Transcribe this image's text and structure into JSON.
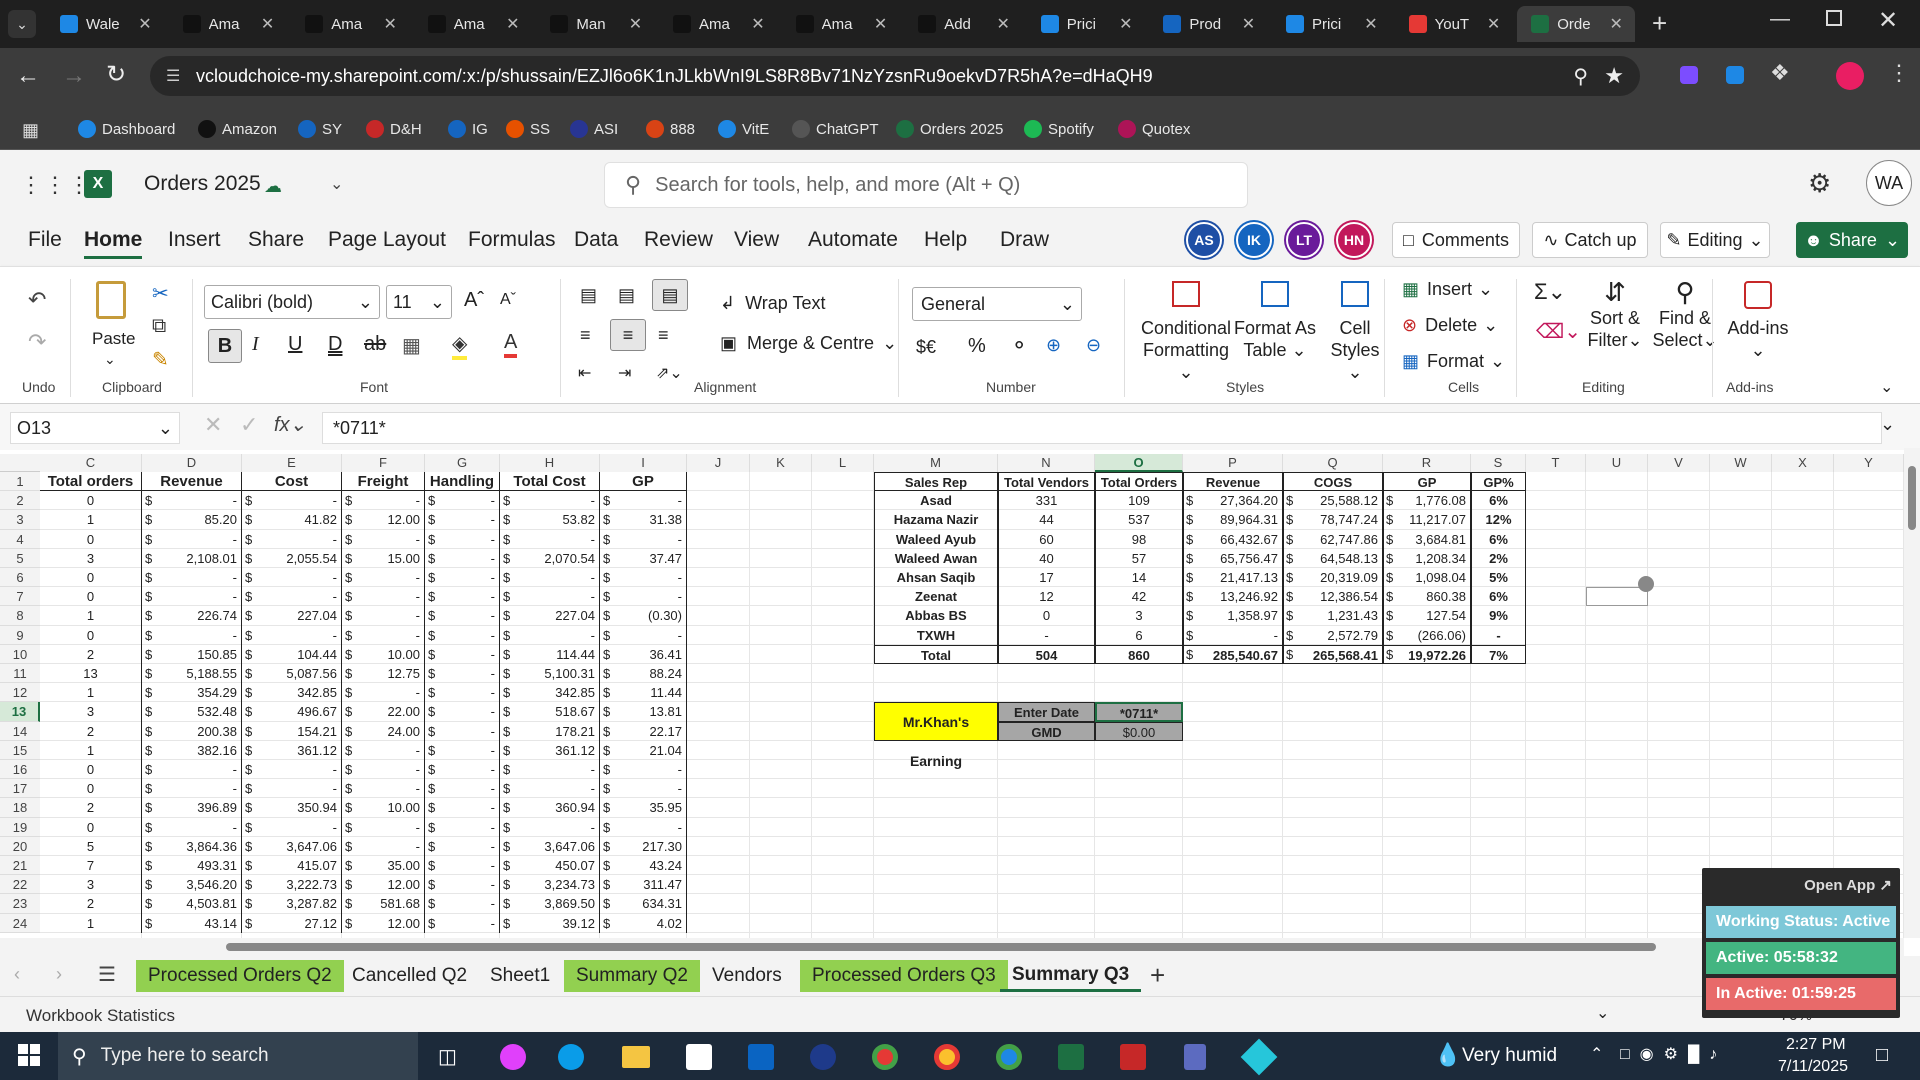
{
  "browser": {
    "tabs": [
      {
        "label": "Wale",
        "icon": "globe-icon",
        "color": "#1e88e5"
      },
      {
        "label": "Ama",
        "icon": "amazon-icon",
        "color": "#111"
      },
      {
        "label": "Ama",
        "icon": "amazon-icon",
        "color": "#111"
      },
      {
        "label": "Ama",
        "icon": "amazon-icon",
        "color": "#111"
      },
      {
        "label": "Man",
        "icon": "amazon-icon",
        "color": "#111"
      },
      {
        "label": "Ama",
        "icon": "amazon-icon",
        "color": "#111"
      },
      {
        "label": "Ama",
        "icon": "amazon-icon",
        "color": "#111"
      },
      {
        "label": "Add",
        "icon": "amazon-icon",
        "color": "#111"
      },
      {
        "label": "Prici",
        "icon": "dollar-icon",
        "color": "#1e88e5"
      },
      {
        "label": "Prod",
        "icon": "ec-icon",
        "color": "#1565c0"
      },
      {
        "label": "Prici",
        "icon": "dollar-icon",
        "color": "#1e88e5"
      },
      {
        "label": "YouT",
        "icon": "youtube-icon",
        "color": "#e53935"
      },
      {
        "label": "Orde",
        "icon": "excel-icon",
        "color": "#1d6f42"
      }
    ],
    "url": "vcloudchoice-my.sharepoint.com/:x:/p/shussain/EZJl6o6K1nJLkbWnI9LS8R8Bv71NzYzsnRu9oekvD7R5hA?e=dHaQH9",
    "bookmarks": [
      {
        "label": "Dashboard",
        "color": "#1e88e5"
      },
      {
        "label": "Amazon",
        "color": "#111"
      },
      {
        "label": "SY",
        "color": "#1565c0"
      },
      {
        "label": "D&H",
        "color": "#c62828"
      },
      {
        "label": "IG",
        "color": "#1565c0"
      },
      {
        "label": "SS",
        "color": "#e65100"
      },
      {
        "label": "ASI",
        "color": "#283593"
      },
      {
        "label": "888",
        "color": "#d84315"
      },
      {
        "label": "VitE",
        "color": "#1e88e5"
      },
      {
        "label": "ChatGPT",
        "color": "#555"
      },
      {
        "label": "Orders 2025",
        "color": "#1d6f42"
      },
      {
        "label": "Spotify",
        "color": "#1db954"
      },
      {
        "label": "Quotex",
        "color": "#ad1457"
      }
    ]
  },
  "excel": {
    "doc_title": "Orders 2025",
    "search_placeholder": "Search for tools, help, and more (Alt + Q)",
    "avatar": "WA",
    "menu": [
      "File",
      "Home",
      "Insert",
      "Share",
      "Page Layout",
      "Formulas",
      "Data",
      "Review",
      "View",
      "Automate",
      "Help",
      "Draw"
    ],
    "collaborators": [
      {
        "initials": "AS",
        "color": "#1e4fa5"
      },
      {
        "initials": "IK",
        "color": "#1565c0"
      },
      {
        "initials": "LT",
        "color": "#6a1b9a"
      },
      {
        "initials": "HN",
        "color": "#c2185b"
      }
    ],
    "comments_label": "Comments",
    "catchup_label": "Catch up",
    "editing_label": "Editing",
    "share_label": "Share",
    "ribbon": {
      "undo": "Undo",
      "paste": "Paste",
      "clipboard": "Clipboard",
      "font_name": "Calibri (bold)",
      "font_size": "11",
      "font": "Font",
      "wrap_text": "Wrap Text",
      "merge_centre": "Merge & Centre",
      "alignment": "Alignment",
      "number_format": "General",
      "number": "Number",
      "conditional": "Conditional",
      "formatting": "Formatting",
      "format_as": "Format As",
      "table": "Table",
      "cell": "Cell",
      "styles_btn": "Styles",
      "styles": "Styles",
      "insert": "Insert",
      "delete": "Delete",
      "format": "Format",
      "cells": "Cells",
      "sort": "Sort &",
      "filter": "Filter",
      "find": "Find &",
      "select": "Select",
      "editing": "Editing",
      "addins": "Add-ins",
      "addins_group": "Add-ins",
      "currency": "$€"
    },
    "namebox": "O13",
    "formula": "*0711*",
    "columns_left": [
      "C",
      "D",
      "E",
      "F",
      "G",
      "H",
      "I",
      "J",
      "K",
      "L"
    ],
    "columns_right": [
      "M",
      "N",
      "O",
      "P",
      "Q",
      "R",
      "S",
      "T",
      "U",
      "V",
      "W",
      "X",
      "Y"
    ],
    "left_headers": [
      "Total orders",
      "Revenue",
      "Cost",
      "Freight",
      "Handling",
      "Total Cost",
      "GP"
    ],
    "left_rows": [
      [
        "0",
        "-",
        "-",
        "-",
        "-",
        "-",
        "-"
      ],
      [
        "1",
        "85.20",
        "41.82",
        "12.00",
        "-",
        "53.82",
        "31.38"
      ],
      [
        "0",
        "-",
        "-",
        "-",
        "-",
        "-",
        "-"
      ],
      [
        "3",
        "2,108.01",
        "2,055.54",
        "15.00",
        "-",
        "2,070.54",
        "37.47"
      ],
      [
        "0",
        "-",
        "-",
        "-",
        "-",
        "-",
        "-"
      ],
      [
        "0",
        "-",
        "-",
        "-",
        "-",
        "-",
        "-"
      ],
      [
        "1",
        "226.74",
        "227.04",
        "-",
        "-",
        "227.04",
        "(0.30)"
      ],
      [
        "0",
        "-",
        "-",
        "-",
        "-",
        "-",
        "-"
      ],
      [
        "2",
        "150.85",
        "104.44",
        "10.00",
        "-",
        "114.44",
        "36.41"
      ],
      [
        "13",
        "5,188.55",
        "5,087.56",
        "12.75",
        "-",
        "5,100.31",
        "88.24"
      ],
      [
        "1",
        "354.29",
        "342.85",
        "-",
        "-",
        "342.85",
        "11.44"
      ],
      [
        "3",
        "532.48",
        "496.67",
        "22.00",
        "-",
        "518.67",
        "13.81"
      ],
      [
        "2",
        "200.38",
        "154.21",
        "24.00",
        "-",
        "178.21",
        "22.17"
      ],
      [
        "1",
        "382.16",
        "361.12",
        "-",
        "-",
        "361.12",
        "21.04"
      ],
      [
        "0",
        "-",
        "-",
        "-",
        "-",
        "-",
        "-"
      ],
      [
        "0",
        "-",
        "-",
        "-",
        "-",
        "-",
        "-"
      ],
      [
        "2",
        "396.89",
        "350.94",
        "10.00",
        "-",
        "360.94",
        "35.95"
      ],
      [
        "0",
        "-",
        "-",
        "-",
        "-",
        "-",
        "-"
      ],
      [
        "5",
        "3,864.36",
        "3,647.06",
        "-",
        "-",
        "3,647.06",
        "217.30"
      ],
      [
        "7",
        "493.31",
        "415.07",
        "35.00",
        "-",
        "450.07",
        "43.24"
      ],
      [
        "3",
        "3,546.20",
        "3,222.73",
        "12.00",
        "-",
        "3,234.73",
        "311.47"
      ],
      [
        "2",
        "4,503.81",
        "3,287.82",
        "581.68",
        "-",
        "3,869.50",
        "634.31"
      ],
      [
        "1",
        "43.14",
        "27.12",
        "12.00",
        "-",
        "39.12",
        "4.02"
      ]
    ],
    "summary_headers": [
      "Sales Rep",
      "Total Vendors",
      "Total Orders",
      "Revenue",
      "COGS",
      "GP",
      "GP%"
    ],
    "summary_rows": [
      [
        "Asad",
        "331",
        "109",
        "27,364.20",
        "25,588.12",
        "1,776.08",
        "6%"
      ],
      [
        "Hazama Nazir",
        "44",
        "537",
        "89,964.31",
        "78,747.24",
        "11,217.07",
        "12%"
      ],
      [
        "Waleed Ayub",
        "60",
        "98",
        "66,432.67",
        "62,747.86",
        "3,684.81",
        "6%"
      ],
      [
        "Waleed Awan",
        "40",
        "57",
        "65,756.47",
        "64,548.13",
        "1,208.34",
        "2%"
      ],
      [
        "Ahsan Saqib",
        "17",
        "14",
        "21,417.13",
        "20,319.09",
        "1,098.04",
        "5%"
      ],
      [
        "Zeenat",
        "12",
        "42",
        "13,246.92",
        "12,386.54",
        "860.38",
        "6%"
      ],
      [
        "Abbas BS",
        "0",
        "3",
        "1,358.97",
        "1,231.43",
        "127.54",
        "9%"
      ],
      [
        "TXWH",
        "-",
        "6",
        "-",
        "2,572.79",
        "(266.06)",
        "-"
      ],
      [
        "Total",
        "504",
        "860",
        "285,540.67",
        "265,568.41",
        "19,972.26",
        "7%"
      ]
    ],
    "earning_label": "Mr.Khan's Earning",
    "enter_date_label": "Enter Date",
    "enter_date_value": "*0711*",
    "gmd_label": "GMD",
    "gmd_value": "$0.00",
    "sheets": [
      {
        "label": "Processed Orders Q2",
        "color": "#92d050",
        "active": false
      },
      {
        "label": "Cancelled Q2",
        "color": "",
        "active": false
      },
      {
        "label": "Sheet1",
        "color": "",
        "active": false
      },
      {
        "label": "Summary Q2",
        "color": "#92d050",
        "active": false
      },
      {
        "label": "Vendors",
        "color": "",
        "active": false
      },
      {
        "label": "Processed Orders Q3",
        "color": "#92d050",
        "active": false
      },
      {
        "label": "Summary Q3",
        "color": "",
        "active": true
      }
    ],
    "status_left": "Workbook Statistics",
    "zoom": "70%"
  },
  "widget": {
    "open_app": "Open App",
    "working": "Working Status: Active",
    "active": "Active: 05:58:32",
    "inactive": "In Active: 01:59:25"
  },
  "taskbar": {
    "search_placeholder": "Type here to search",
    "weather": "Very humid",
    "time": "2:27 PM",
    "date": "7/11/2025"
  }
}
